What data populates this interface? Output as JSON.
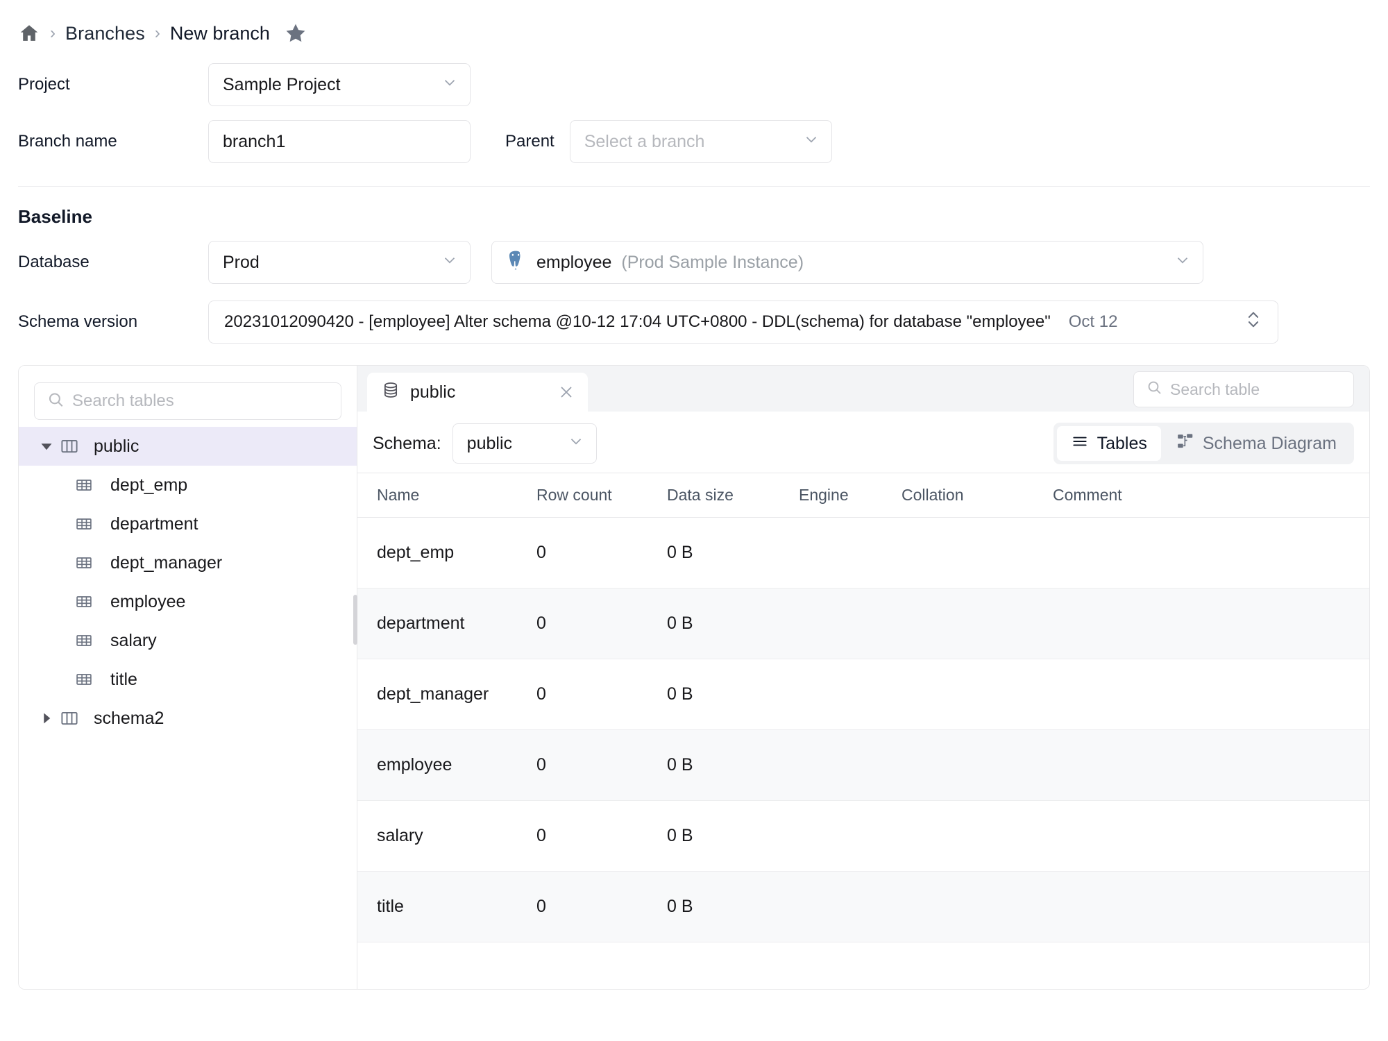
{
  "breadcrumb": {
    "home_icon": "home-icon",
    "separator": "›",
    "items": [
      "Branches",
      "New branch"
    ],
    "star_icon": "star-icon"
  },
  "form": {
    "project": {
      "label": "Project",
      "value": "Sample Project"
    },
    "branch_name": {
      "label": "Branch name",
      "value": "branch1"
    },
    "parent": {
      "label": "Parent",
      "placeholder": "Select a branch"
    }
  },
  "baseline": {
    "title": "Baseline",
    "database": {
      "label": "Database",
      "value": "Prod"
    },
    "instance": {
      "icon": "postgres-icon",
      "name": "employee",
      "sub": "(Prod Sample Instance)"
    },
    "schema_version": {
      "label": "Schema version",
      "value": "20231012090420 - [employee] Alter schema @10-12 17:04 UTC+0800 - DDL(schema) for database \"employee\"",
      "date": "Oct 12"
    }
  },
  "tree": {
    "search_placeholder": "Search tables",
    "nodes": [
      {
        "label": "public",
        "type": "schema",
        "expanded": true,
        "selected": true
      },
      {
        "label": "dept_emp",
        "type": "table"
      },
      {
        "label": "department",
        "type": "table"
      },
      {
        "label": "dept_manager",
        "type": "table"
      },
      {
        "label": "employee",
        "type": "table"
      },
      {
        "label": "salary",
        "type": "table"
      },
      {
        "label": "title",
        "type": "table"
      },
      {
        "label": "schema2",
        "type": "schema",
        "expanded": false,
        "selected": false
      }
    ]
  },
  "main": {
    "tab": {
      "label": "public",
      "icon": "database-icon",
      "close_icon": "close-icon"
    },
    "search_placeholder": "Search table",
    "schema_label": "Schema:",
    "schema_value": "public",
    "views": [
      {
        "label": "Tables",
        "icon": "list-icon",
        "active": true
      },
      {
        "label": "Schema Diagram",
        "icon": "diagram-icon",
        "active": false
      }
    ],
    "table": {
      "columns": [
        "Name",
        "Row count",
        "Data size",
        "Engine",
        "Collation",
        "Comment"
      ],
      "rows": [
        {
          "name": "dept_emp",
          "row_count": "0",
          "data_size": "0 B",
          "engine": "",
          "collation": "",
          "comment": ""
        },
        {
          "name": "department",
          "row_count": "0",
          "data_size": "0 B",
          "engine": "",
          "collation": "",
          "comment": ""
        },
        {
          "name": "dept_manager",
          "row_count": "0",
          "data_size": "0 B",
          "engine": "",
          "collation": "",
          "comment": ""
        },
        {
          "name": "employee",
          "row_count": "0",
          "data_size": "0 B",
          "engine": "",
          "collation": "",
          "comment": ""
        },
        {
          "name": "salary",
          "row_count": "0",
          "data_size": "0 B",
          "engine": "",
          "collation": "",
          "comment": ""
        },
        {
          "name": "title",
          "row_count": "0",
          "data_size": "0 B",
          "engine": "",
          "collation": "",
          "comment": ""
        }
      ]
    }
  },
  "colors": {
    "selected_row": "#eceaf8",
    "alt_row": "#f8f9fa",
    "tabbar": "#f3f4f6",
    "border": "#e4e4e7",
    "placeholder": "#b6b8bd"
  }
}
